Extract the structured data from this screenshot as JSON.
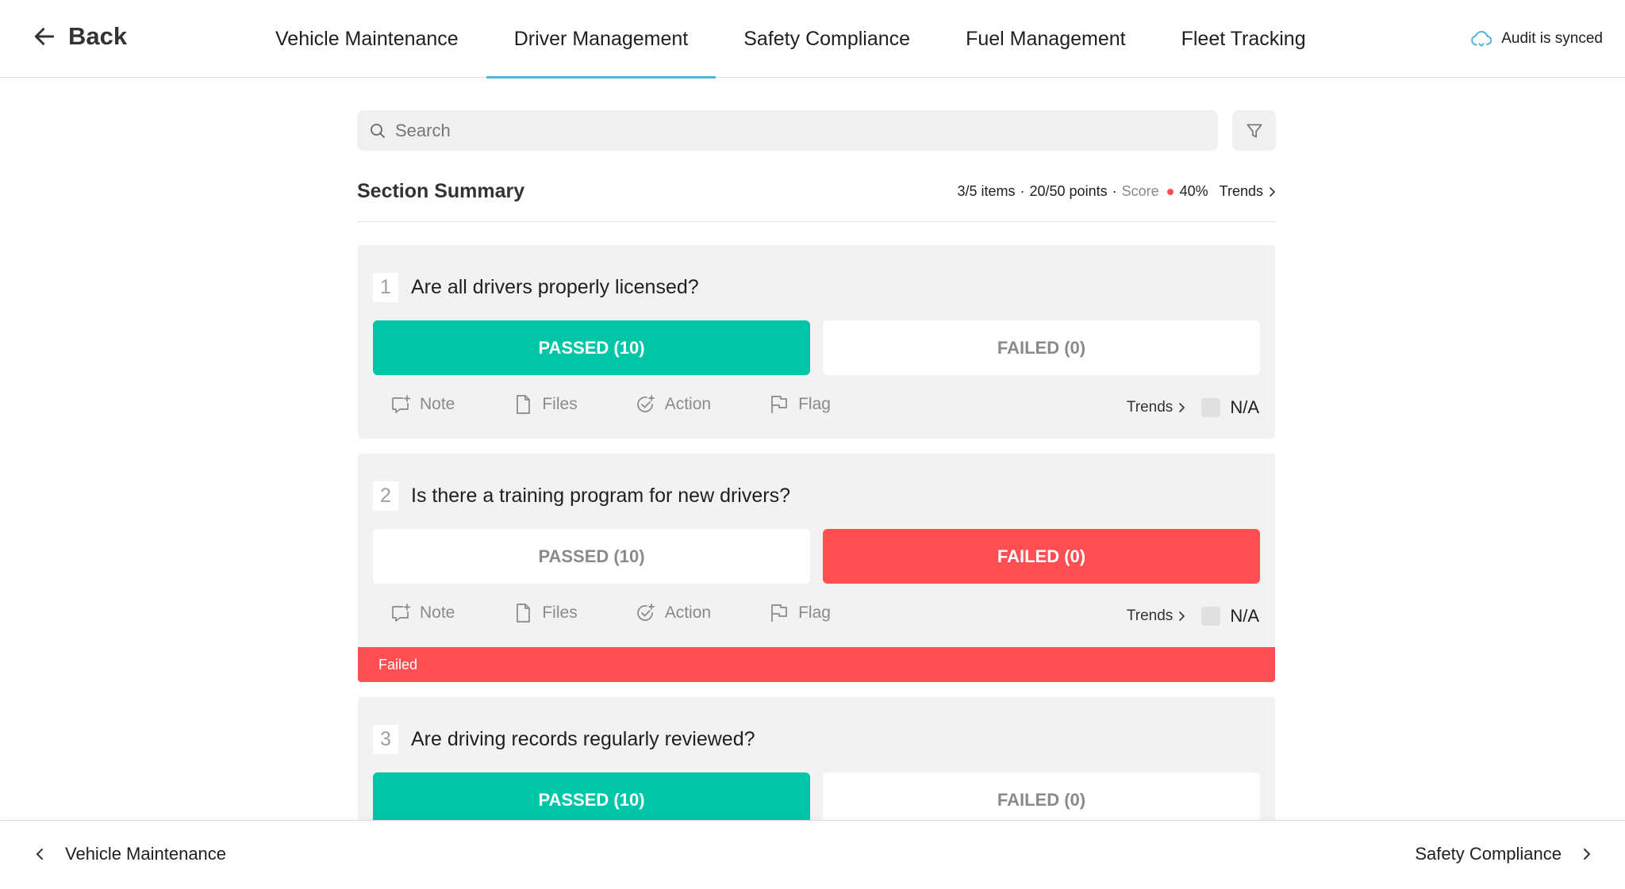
{
  "header": {
    "back_label": "Back",
    "tabs": [
      {
        "label": "Vehicle Maintenance"
      },
      {
        "label": "Driver Management"
      },
      {
        "label": "Safety Compliance"
      },
      {
        "label": "Fuel Management"
      },
      {
        "label": "Fleet Tracking"
      }
    ],
    "active_tab": "Driver Management",
    "sync_status": "Audit is synced"
  },
  "search": {
    "placeholder": "Search"
  },
  "summary": {
    "title": "Section Summary",
    "items": "3/5 items",
    "points": "20/50 points",
    "score_label": "Score",
    "score_value": "40%",
    "trends_label": "Trends"
  },
  "questions": [
    {
      "number": "1",
      "text": "Are all drivers properly licensed?",
      "pass_label": "PASSED (10)",
      "fail_label": "FAILED (0)",
      "result": "passed",
      "actions": {
        "note": "Note",
        "files": "Files",
        "action": "Action",
        "flag": "Flag"
      },
      "trends_label": "Trends",
      "na_label": "N/A"
    },
    {
      "number": "2",
      "text": "Is there a training program for new drivers?",
      "pass_label": "PASSED (10)",
      "fail_label": "FAILED (0)",
      "result": "failed",
      "actions": {
        "note": "Note",
        "files": "Files",
        "action": "Action",
        "flag": "Flag"
      },
      "trends_label": "Trends",
      "na_label": "N/A",
      "banner": "Failed"
    },
    {
      "number": "3",
      "text": "Are driving records regularly reviewed?",
      "pass_label": "PASSED (10)",
      "fail_label": "FAILED (0)",
      "result": "passed"
    }
  ],
  "footer": {
    "prev_label": "Vehicle Maintenance",
    "next_label": "Safety Compliance"
  },
  "colors": {
    "pass": "#00c6a7",
    "fail": "#ff4f52",
    "tab_underline": "#4fb8d8",
    "card_bg": "#f2f2f2"
  },
  "icons": [
    "arrow-left-icon",
    "cloud-sync-icon",
    "search-icon",
    "filter-icon",
    "note-icon",
    "file-icon",
    "action-check-icon",
    "flag-icon",
    "chevron-right-icon",
    "chevron-left-icon"
  ]
}
